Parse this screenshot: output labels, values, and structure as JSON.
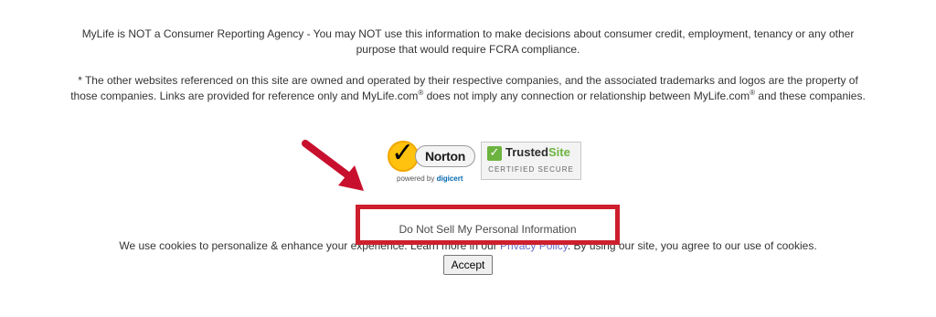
{
  "disclaimer": {
    "fcra": "MyLife is NOT a Consumer Reporting Agency - You may NOT use this information to make decisions about consumer credit, employment, tenancy or any other purpose that would require FCRA compliance.",
    "trademark_part1": "* The other websites referenced on this site are owned and operated by their respective companies, and the associated trademarks and logos are the property of those companies. Links are provided for reference only and MyLife.com",
    "trademark_part2": " does not imply any connection or relationship between MyLife.com",
    "trademark_part3": " and these companies.",
    "registered_mark": "®"
  },
  "badges": {
    "norton": {
      "name": "Norton",
      "powered_by": "powered by",
      "provider": "digicert"
    },
    "trusted_site": {
      "name_part1": "Trusted",
      "name_part2": "Site",
      "subtitle": "CERTIFIED SECURE"
    }
  },
  "do_not_sell": {
    "label": "Do Not Sell My Personal Information"
  },
  "cookie_banner": {
    "text_before": "We use cookies to personalize & enhance your experience. Learn more in our ",
    "privacy_link": "Privacy Policy",
    "text_after": ". By using our site, you agree to our use of cookies.",
    "accept_label": "Accept"
  },
  "colors": {
    "highlight_border": "#cd1f2d",
    "arrow": "#c8102e",
    "norton_yellow": "#ffc20e",
    "trusted_green": "#6cb33f",
    "link": "#6a6ac8"
  }
}
